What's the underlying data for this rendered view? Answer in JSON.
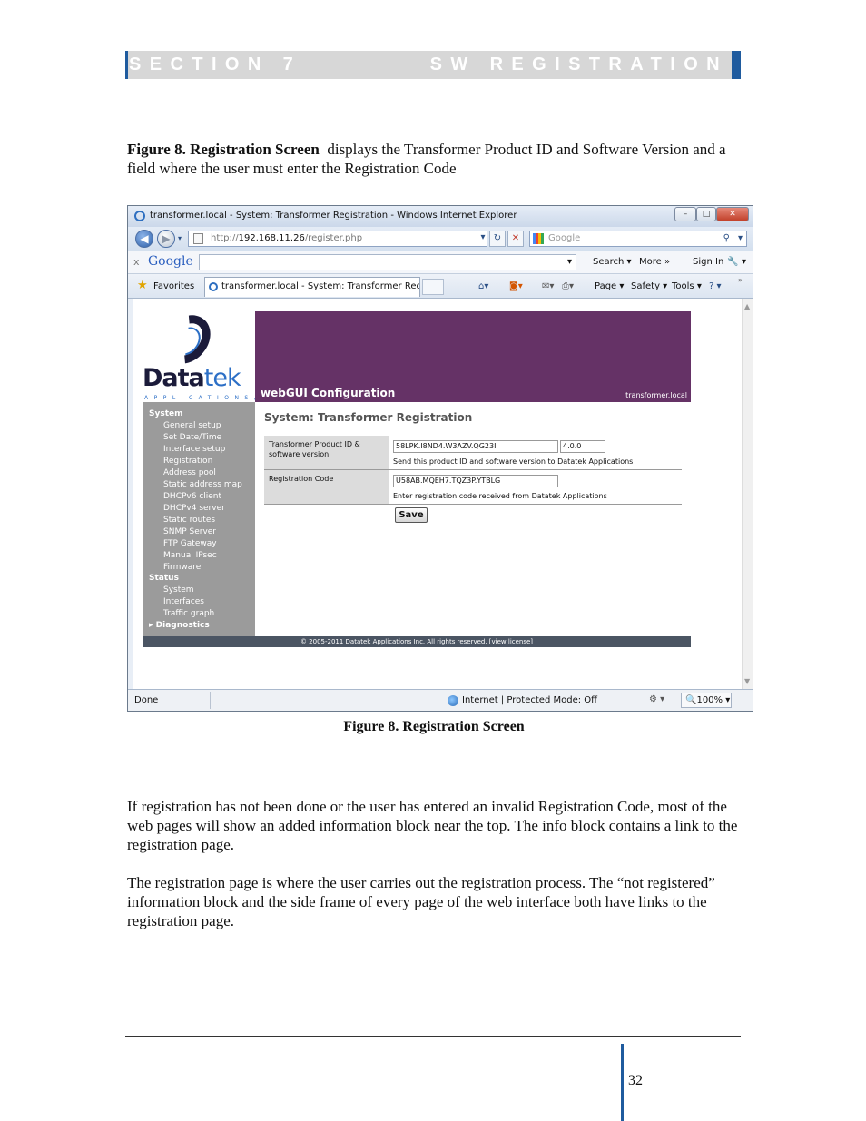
{
  "header": {
    "section": "SECTION 7",
    "title": "SW REGISTRATION"
  },
  "intro": {
    "bold": "Figure 8. Registration Screen",
    "text": "displays the Transformer Product ID and Software Version and a field where the user must enter the Registration Code"
  },
  "browser": {
    "window_title": "transformer.local - System: Transformer Registration - Windows Internet Explorer",
    "window_buttons": [
      "–",
      "□",
      "✕"
    ],
    "address_scheme": "http://",
    "address_host": "192.168.11.26",
    "address_path": "/register.php",
    "search_placeholder": "Google",
    "google_toolbar": {
      "close": "x",
      "logo": "Google",
      "search": "Search ▾",
      "more": "More »",
      "signin": "Sign In",
      "tools": "▾"
    },
    "favorites_label": "Favorites",
    "tab_title": "transformer.local - System: Transformer Registrat...",
    "commands": {
      "page": "Page ▾",
      "safety": "Safety ▾",
      "tools": "Tools ▾",
      "help": "? ▾"
    },
    "status": {
      "done": "Done",
      "zone": "Internet | Protected Mode: Off",
      "zoom": "100% ▾"
    }
  },
  "webgui": {
    "logo_text_bold": "Data",
    "logo_text_light": "tek",
    "logo_sub": "APPLICATIONS, INC",
    "banner_title": "webGUI Configuration",
    "banner_host": "transformer.local",
    "sidebar": {
      "system_head": "System",
      "system_items": [
        "General setup",
        "Set Date/Time",
        "Interface setup",
        "Registration",
        "Address pool",
        "Static address map",
        "DHCPv6 client",
        "DHCPv4 server",
        "Static routes",
        "SNMP Server",
        "FTP Gateway",
        "Manual IPsec",
        "Firmware"
      ],
      "status_head": "Status",
      "status_items": [
        "System",
        "Interfaces",
        "Traffic graph"
      ],
      "diagnostics": "▸ Diagnostics"
    },
    "page_title": "System: Transformer Registration",
    "form": {
      "product_label": "Transformer Product ID & software version",
      "product_id": "58LPK.I8ND4.W3AZV.QG23I",
      "version": "4.0.0",
      "product_note": "Send this product ID and software version to Datatek Applications",
      "code_label": "Registration Code",
      "code_value": "U58AB.MQEH7.TQZ3P.YTBLG",
      "code_note": "Enter registration code received from Datatek Applications",
      "save": "Save"
    },
    "footer": "© 2005-2011 Datatek Applications Inc. All rights reserved.   [view license]"
  },
  "caption": "Figure 8. Registration Screen",
  "body": {
    "p1": "If registration has not been done or the user has entered an invalid Registration Code, most of the web pages will show an added information block near the top. The info block contains a link to the registration page.",
    "p2": "The registration page is where the user carries out the registration process. The “not registered” information block and the side frame of every page of the web interface both have links to the registration page."
  },
  "page_number": "32"
}
